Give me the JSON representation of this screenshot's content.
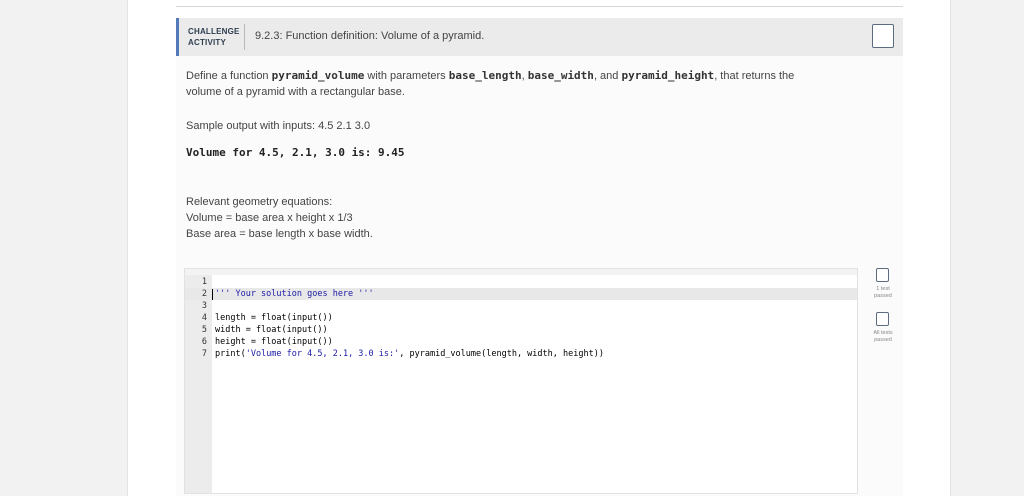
{
  "header": {
    "label_line1": "CHALLENGE",
    "label_line2": "ACTIVITY",
    "title": "9.2.3: Function definition: Volume of a pyramid."
  },
  "description": {
    "text_before_fn": "Define a function ",
    "function_name": "pyramid_volume",
    "text_params": " with parameters ",
    "param1": "base_length",
    "sep1": ", ",
    "param2": "base_width",
    "sep2": ", and ",
    "param3": "pyramid_height",
    "text_after": ", that returns the",
    "line2": "volume of a pyramid with a rectangular base."
  },
  "sample": {
    "intro": "Sample output with inputs: 4.5 2.1 3.0",
    "output": "Volume for 4.5, 2.1, 3.0 is: 9.45"
  },
  "equations": {
    "heading": "Relevant geometry equations:",
    "volume": "Volume = base area x height x 1/3",
    "base_area": "Base area = base length x base width."
  },
  "editor": {
    "lines": [
      {
        "num": "1",
        "text": ""
      },
      {
        "num": "2",
        "text": "''' Your solution goes here '''"
      },
      {
        "num": "3",
        "text": ""
      },
      {
        "num": "4",
        "text": "length = float(input())"
      },
      {
        "num": "5",
        "text": "width = float(input())"
      },
      {
        "num": "6",
        "text": "height = float(input())"
      },
      {
        "num": "7",
        "text_prefix": "print(",
        "text_string": "'Volume for 4.5, 2.1, 3.0 is:'",
        "text_suffix": ", pyramid_volume(length, width, height))"
      }
    ]
  },
  "checks": [
    {
      "label_line1": "1 test",
      "label_line2": "passed"
    },
    {
      "label_line1": "All tests",
      "label_line2": "passed"
    }
  ],
  "colors": {
    "accent": "#5279b8",
    "string": "#1a1aa6"
  }
}
